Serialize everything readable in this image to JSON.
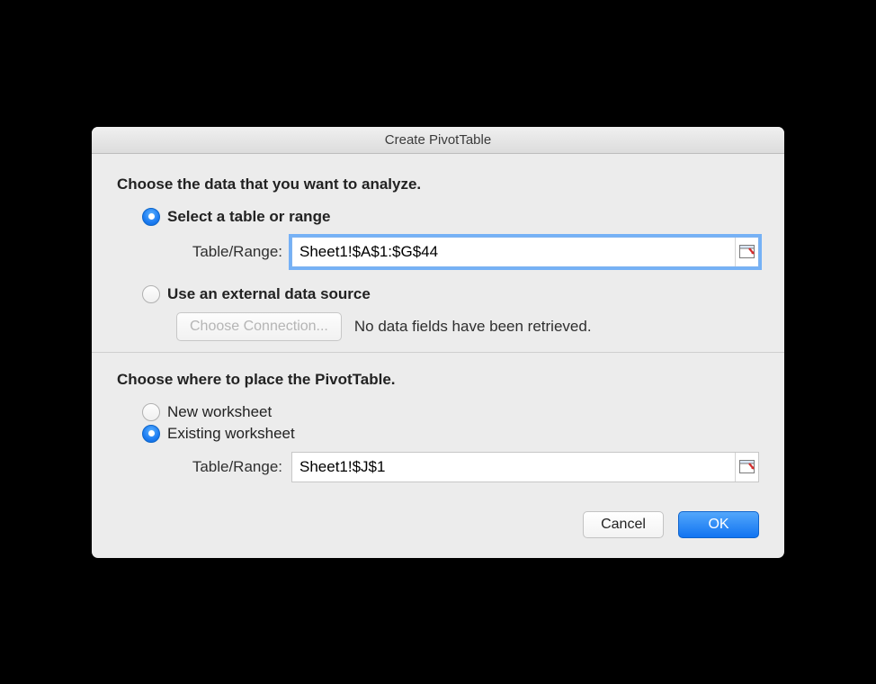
{
  "dialog": {
    "title": "Create PivotTable"
  },
  "dataSection": {
    "heading": "Choose the data that you want to analyze.",
    "options": {
      "selectRange": {
        "label": "Select a table or range",
        "selected": true,
        "fieldLabel": "Table/Range:",
        "value": "Sheet1!$A$1:$G$44"
      },
      "external": {
        "label": "Use an external data source",
        "selected": false,
        "chooseButton": "Choose Connection...",
        "status": "No data fields have been retrieved."
      }
    }
  },
  "placement": {
    "heading": "Choose where to place the PivotTable.",
    "options": {
      "newSheet": {
        "label": "New worksheet",
        "selected": false
      },
      "existing": {
        "label": "Existing worksheet",
        "selected": true,
        "fieldLabel": "Table/Range:",
        "value": "Sheet1!$J$1"
      }
    }
  },
  "footer": {
    "cancel": "Cancel",
    "ok": "OK"
  }
}
